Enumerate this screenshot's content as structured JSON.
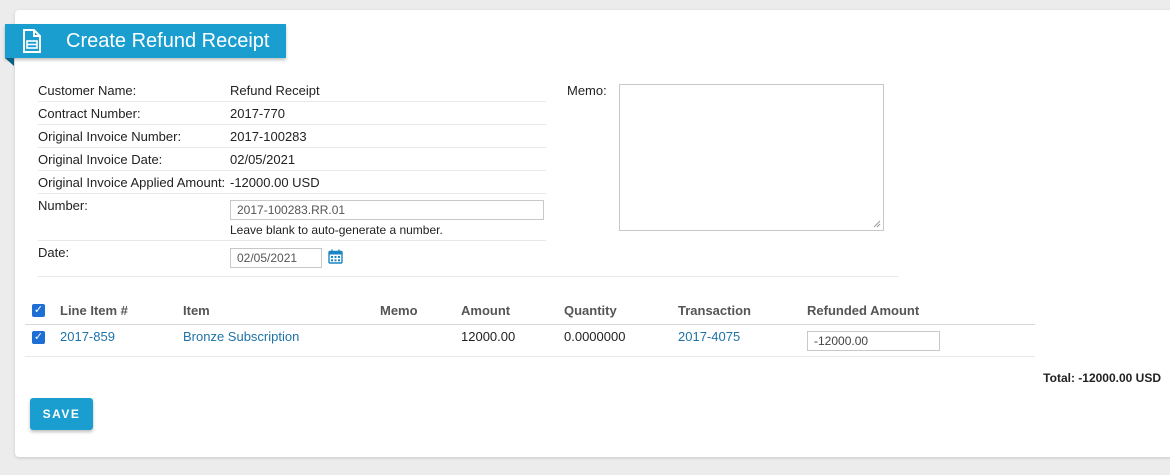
{
  "header": {
    "title": "Create Refund Receipt",
    "icon": "document-icon"
  },
  "info": {
    "customer_name_label": "Customer Name:",
    "customer_name_value": "Refund Receipt",
    "contract_number_label": "Contract Number:",
    "contract_number_value": "2017-770",
    "orig_invoice_number_label": "Original Invoice Number:",
    "orig_invoice_number_value": "2017-100283",
    "orig_invoice_date_label": "Original Invoice Date:",
    "orig_invoice_date_value": "02/05/2021",
    "orig_applied_amount_label": "Original Invoice Applied Amount:",
    "orig_applied_amount_value": "-12000.00 USD",
    "number_label": "Number:",
    "number_value": "2017-100283.RR.01",
    "number_hint": "Leave blank to auto-generate a number.",
    "date_label": "Date:",
    "date_value": "02/05/2021",
    "memo_label": "Memo:",
    "memo_value": ""
  },
  "table": {
    "headers": {
      "line_item": "Line Item #",
      "item": "Item",
      "memo": "Memo",
      "amount": "Amount",
      "quantity": "Quantity",
      "transaction": "Transaction",
      "refunded_amount": "Refunded Amount"
    },
    "rows": [
      {
        "selected": true,
        "line_item": "2017-859",
        "item": "Bronze Subscription",
        "memo": "",
        "amount": "12000.00",
        "quantity": "0.0000000",
        "transaction": "2017-4075",
        "refunded_amount": "-12000.00"
      }
    ],
    "select_all": true
  },
  "total": "Total: -12000.00 USD",
  "actions": {
    "save_label": "SAVE"
  },
  "colors": {
    "accent": "#1a9ecf",
    "link": "#1e73a8",
    "checkbox": "#1d6fd6"
  }
}
